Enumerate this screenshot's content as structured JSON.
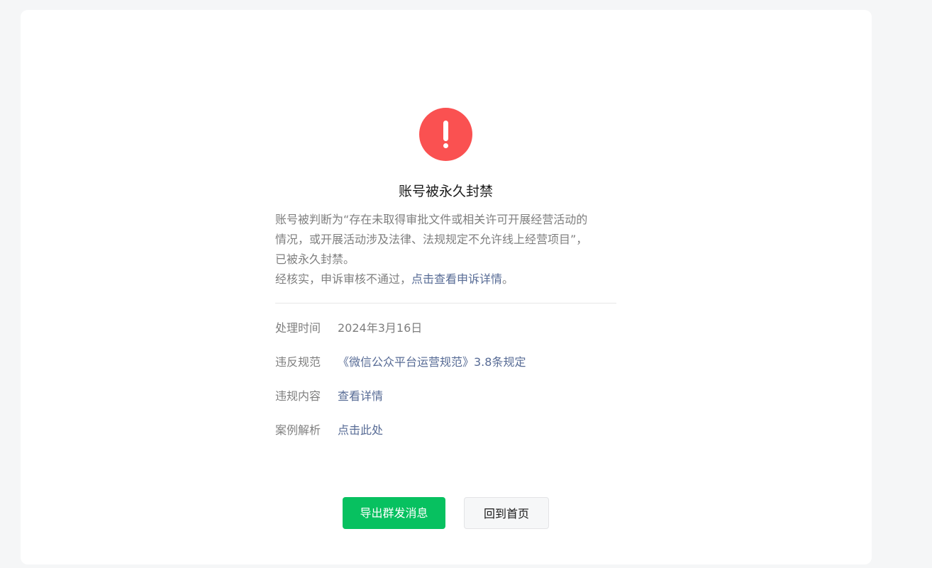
{
  "status": {
    "icon": "exclamation-circle-icon",
    "color": "#fa5151",
    "title": "账号被永久封禁"
  },
  "description": {
    "line1": "账号被判断为“存在未取得审批文件或相关许可开展经营活动的",
    "line2": "情况，或开展活动涉及法律、法规规定不允许线上经营项目”，",
    "line3": "已被永久封禁。",
    "appeal_text": "经核实，申诉审核不通过，",
    "appeal_link": "点击查看申诉详情",
    "appeal_end": "。"
  },
  "info": [
    {
      "label": "处理时间",
      "value": "2024年3月16日"
    },
    {
      "label": "违反规范",
      "value": "《微信公众平台运营规范》3.8条规定"
    },
    {
      "label": "违规内容",
      "value": "查看详情"
    },
    {
      "label": "案例解析",
      "value": "点击此处"
    }
  ],
  "buttons": {
    "export_label": "导出群发消息",
    "home_label": "回到首页"
  },
  "colors": {
    "primary": "#07c160",
    "link": "#576b95",
    "danger": "#fa5151"
  }
}
